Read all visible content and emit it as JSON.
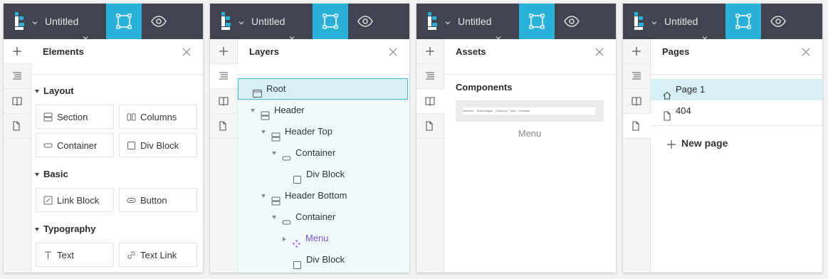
{
  "common": {
    "title": "Untitled",
    "colors": {
      "topbar": "#3f4450",
      "accent": "#29b1d8",
      "logo_blue": "#29b1d8",
      "logo_white": "#ffffff"
    }
  },
  "elements_panel": {
    "title": "Elements",
    "sections": [
      {
        "label": "Layout",
        "items": [
          {
            "label": "Section",
            "icon": "section-icon"
          },
          {
            "label": "Columns",
            "icon": "columns-icon"
          },
          {
            "label": "Container",
            "icon": "container-icon"
          },
          {
            "label": "Div Block",
            "icon": "div-block-icon"
          }
        ]
      },
      {
        "label": "Basic",
        "items": [
          {
            "label": "Link Block",
            "icon": "link-block-icon"
          },
          {
            "label": "Button",
            "icon": "button-icon"
          }
        ]
      },
      {
        "label": "Typography",
        "items": [
          {
            "label": "Text",
            "icon": "text-icon"
          },
          {
            "label": "Text Link",
            "icon": "link-icon"
          }
        ]
      }
    ]
  },
  "layers_panel": {
    "title": "Layers",
    "tree": [
      {
        "label": "Root",
        "icon": "window-icon",
        "depth": 0,
        "arrow": "none",
        "selected": true
      },
      {
        "label": "Header",
        "icon": "section-icon",
        "depth": 1,
        "arrow": "down"
      },
      {
        "label": "Header Top",
        "icon": "section-icon",
        "depth": 2,
        "arrow": "down"
      },
      {
        "label": "Container",
        "icon": "container-icon",
        "depth": 3,
        "arrow": "down"
      },
      {
        "label": "Div Block",
        "icon": "div-block-icon",
        "depth": 4,
        "arrow": "none"
      },
      {
        "label": "Header Bottom",
        "icon": "section-icon",
        "depth": 2,
        "arrow": "down"
      },
      {
        "label": "Container",
        "icon": "container-icon",
        "depth": 3,
        "arrow": "down"
      },
      {
        "label": "Menu",
        "icon": "component-icon",
        "depth": 4,
        "arrow": "right",
        "component": true
      },
      {
        "label": "Div Block",
        "icon": "div-block-icon",
        "depth": 4,
        "arrow": "none"
      }
    ]
  },
  "assets_panel": {
    "title": "Assets",
    "subtitle": "Components",
    "thumb_text": "Services  ·  Technologies  ·  Company  ·  Help  ·  Contacts",
    "caption": "Menu"
  },
  "pages_panel": {
    "title": "Pages",
    "pages": [
      {
        "label": "Page 1",
        "icon": "home-icon",
        "selected": true
      },
      {
        "label": "404",
        "icon": "page-icon",
        "selected": false
      }
    ],
    "new_page": "New page"
  }
}
